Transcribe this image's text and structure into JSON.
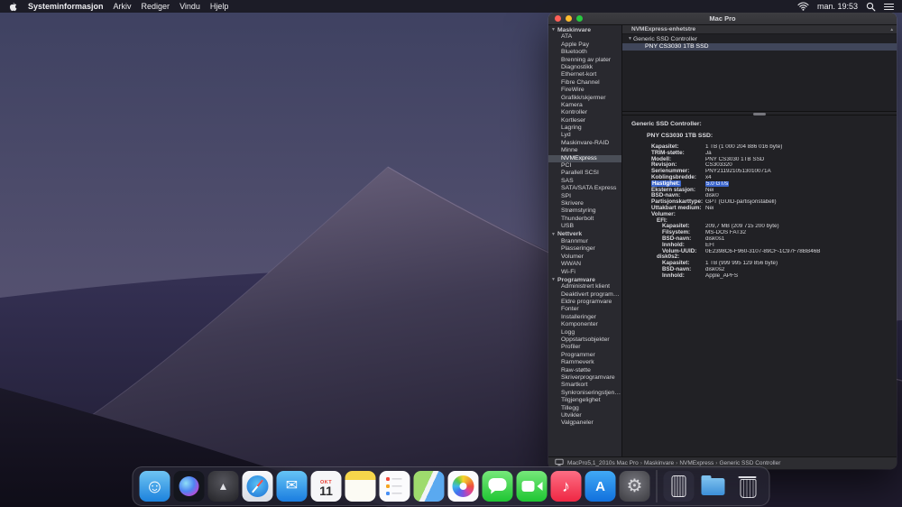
{
  "menu_bar": {
    "app_name": "Systeminformasjon",
    "menus": [
      "Arkiv",
      "Rediger",
      "Vindu",
      "Hjelp"
    ],
    "status": {
      "clock": "man. 19:53"
    }
  },
  "window": {
    "title": "Mac Pro",
    "sidebar": {
      "sections": [
        {
          "label": "Maskinvare",
          "selected_item": "NVMExpress",
          "items": [
            "ATA",
            "Apple Pay",
            "Bluetooth",
            "Brenning av plater",
            "Diagnostikk",
            "Ethernet-kort",
            "Fibre Channel",
            "FireWire",
            "Grafikk/skjermer",
            "Kamera",
            "Kontroller",
            "Kortleser",
            "Lagring",
            "Lyd",
            "Maskinvare-RAID",
            "Minne",
            "NVMExpress",
            "PCI",
            "Parallell SCSI",
            "SAS",
            "SATA/SATA Express",
            "SPI",
            "Skrivere",
            "Strømstyring",
            "Thunderbolt",
            "USB"
          ]
        },
        {
          "label": "Nettverk",
          "selected_item": "",
          "items": [
            "Brannmur",
            "Plasseringer",
            "Volumer",
            "WWAN",
            "Wi-Fi"
          ]
        },
        {
          "label": "Programvare",
          "selected_item": "",
          "items": [
            "Administrert klient",
            "Deaktivert programvare",
            "Eldre programvare",
            "Fonter",
            "Installeringer",
            "Komponenter",
            "Logg",
            "Oppstartsobjekter",
            "Profiler",
            "Programmer",
            "Rammeverk",
            "Raw-støtte",
            "Skriverprogramvare",
            "Smartkort",
            "Synkroniseringstjene...",
            "Tilgjengelighet",
            "Tillegg",
            "Utvikler",
            "Valgpaneler"
          ]
        }
      ]
    },
    "device_tree": {
      "header": "NVMExpress-enhetstre",
      "rows": [
        {
          "label": "Generic SSD Controller",
          "indent": 0,
          "disclosure": true,
          "selected": false
        },
        {
          "label": "PNY CS3030 1TB SSD",
          "indent": 1,
          "disclosure": false,
          "selected": true
        }
      ]
    },
    "details": {
      "controller_title": "Generic SSD Controller:",
      "device_title": "PNY CS3030 1TB SSD:",
      "rows": [
        {
          "label": "Kapasitet:",
          "value": "1 TB (1 000 204 886 016 byte)",
          "indent": 1
        },
        {
          "label": "TRIM-støtte:",
          "value": "Ja",
          "indent": 1
        },
        {
          "label": "Modell:",
          "value": "PNY CS3030 1TB SSD",
          "indent": 1
        },
        {
          "label": "Revisjon:",
          "value": "CS303320",
          "indent": 1
        },
        {
          "label": "Serienummer:",
          "value": "PNY2119210513010071A",
          "indent": 1
        },
        {
          "label": "Koblingsbredde:",
          "value": "x4",
          "indent": 1
        },
        {
          "label": "Hastighet:",
          "value": "5.0 GT/s",
          "indent": 1,
          "highlighted": true
        },
        {
          "label": "Ekstern stasjon:",
          "value": "Nei",
          "indent": 1
        },
        {
          "label": "BSD-navn:",
          "value": "disk0",
          "indent": 1
        },
        {
          "label": "Partisjonskarttype:",
          "value": "GPT (GUID-partisjonstabell)",
          "indent": 1
        },
        {
          "label": "Uttakbart medium:",
          "value": "Nei",
          "indent": 1
        },
        {
          "label": "Volumer:",
          "value": "",
          "indent": 1
        },
        {
          "label": "EFI:",
          "value": "",
          "indent": 2,
          "bold": true
        },
        {
          "label": "Kapasitet:",
          "value": "209,7 MB (209 715 200 byte)",
          "indent": 3
        },
        {
          "label": "Filsystem:",
          "value": "MS-DOS FAT32",
          "indent": 3
        },
        {
          "label": "BSD-navn:",
          "value": "disk0s1",
          "indent": 3
        },
        {
          "label": "Innhold:",
          "value": "EFI",
          "indent": 3
        },
        {
          "label": "Volum-UUID:",
          "value": "0E2398C6-F960-3107-89CF-1C97F78BB46B",
          "indent": 3
        },
        {
          "label": "disk0s2:",
          "value": "",
          "indent": 2,
          "bold": true
        },
        {
          "label": "Kapasitet:",
          "value": "1 TB (999 995 129 856 byte)",
          "indent": 3
        },
        {
          "label": "BSD-navn:",
          "value": "disk0s2",
          "indent": 3
        },
        {
          "label": "Innhold:",
          "value": "Apple_APFS",
          "indent": 3
        }
      ]
    },
    "status_bar": {
      "path": [
        "MacPro5,1_2010s Mac Pro",
        "Maskinvare",
        "NVMExpress",
        "Generic SSD Controller"
      ]
    }
  },
  "dock": {
    "items": [
      {
        "id": "finder"
      },
      {
        "id": "siri"
      },
      {
        "id": "launchpad"
      },
      {
        "id": "safari"
      },
      {
        "id": "mail"
      },
      {
        "id": "calendar",
        "top": "OKT",
        "day": "11"
      },
      {
        "id": "notes"
      },
      {
        "id": "reminders"
      },
      {
        "id": "maps"
      },
      {
        "id": "photos"
      },
      {
        "id": "messages"
      },
      {
        "id": "facetime"
      },
      {
        "id": "music"
      },
      {
        "id": "appstore"
      },
      {
        "id": "sysprefs"
      },
      {
        "id": "separator"
      },
      {
        "id": "macpro"
      },
      {
        "id": "downloads"
      },
      {
        "id": "trash"
      }
    ]
  },
  "colors": {
    "selection_blue": "#3c66cc",
    "tree_selection": "#40465a",
    "sidebar_selection": "#4a4e57"
  }
}
